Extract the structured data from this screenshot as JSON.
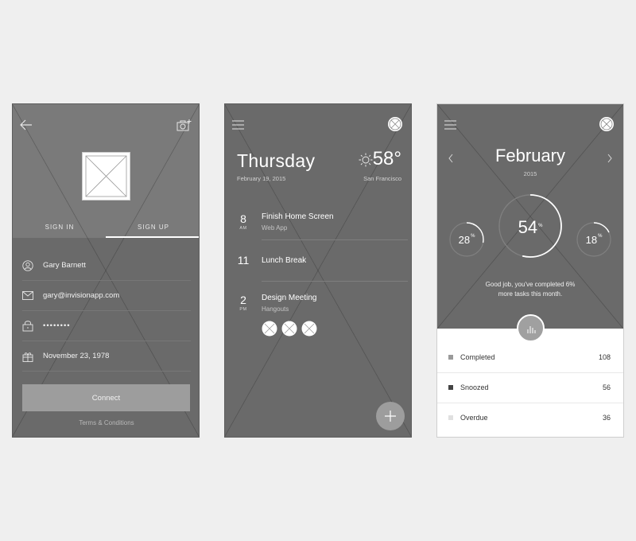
{
  "signup_screen": {
    "tabs": [
      "SIGN IN",
      "SIGN UP"
    ],
    "active_tab": "SIGN UP",
    "fields": {
      "name": "Gary Barnett",
      "email": "gary@invisionapp.com",
      "password": "••••••••",
      "birthday": "November 23, 1978"
    },
    "connect_label": "Connect",
    "terms_label": "Terms & Conditions",
    "icons": [
      "back-arrow-icon",
      "add-photo-icon",
      "user-icon",
      "mail-icon",
      "lock-icon",
      "gift-icon"
    ]
  },
  "agenda_screen": {
    "day": "Thursday",
    "date": "February 19, 2015",
    "temperature": "58°",
    "city": "San Francisco",
    "events": [
      {
        "time": "8",
        "ampm": "AM",
        "title": "Finish Home Screen",
        "subtitle": "Web App"
      },
      {
        "time": "11",
        "ampm": "",
        "title": "Lunch Break",
        "subtitle": ""
      },
      {
        "time": "2",
        "ampm": "PM",
        "title": "Design Meeting",
        "subtitle": "Hangouts"
      }
    ],
    "icons": [
      "menu-icon",
      "close-icon",
      "sun-icon",
      "add-icon"
    ]
  },
  "stats_screen": {
    "month": "February",
    "year": "2015",
    "rings": [
      {
        "value": "28",
        "unit": "%",
        "percent": 28
      },
      {
        "value": "54",
        "unit": "%",
        "percent": 54
      },
      {
        "value": "18",
        "unit": "%",
        "percent": 18
      }
    ],
    "message_line1": "Good job, you've completed 6%",
    "message_line2": "more tasks this month.",
    "stats": [
      {
        "label": "Completed",
        "count": "108",
        "color": "#9a9a9a"
      },
      {
        "label": "Snoozed",
        "count": "56",
        "color": "#444444"
      },
      {
        "label": "Overdue",
        "count": "36",
        "color": "#e0e0e0"
      }
    ],
    "icons": [
      "menu-icon",
      "close-icon",
      "chevron-left-icon",
      "chevron-right-icon",
      "bar-chart-icon"
    ]
  }
}
